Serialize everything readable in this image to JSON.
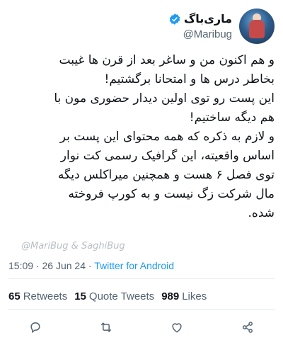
{
  "user": {
    "display_name": "ماری‌باگ",
    "handle": "@Maribug"
  },
  "tweet": {
    "lines": [
      "و هم اکنون من و ساغر بعد از قرن ها غیبت",
      "بخاطر درس ها و امتحانا برگشتیم!",
      "این پست رو توی اولین دیدار حضوری مون با",
      "هم دیگه ساختیم!",
      "و لازم به ذکره که همه محتوای این پست بر",
      "اساس واقعیته، این گرافیک رسمی کت نوار",
      "توی فصل ۶ هست و همچنین میراکلس دیگه",
      "مال شرکت زگ نیست و به کورپ فروخته",
      "شده."
    ],
    "watermark": "@MariBug & SaghiBug"
  },
  "meta": {
    "time": "15:09",
    "separator1": " · ",
    "date": "26 Jun 24",
    "separator2": " · ",
    "source": "Twitter for Android"
  },
  "stats": {
    "retweets_count": "65",
    "retweets_label": "Retweets",
    "quotes_count": "15",
    "quotes_label": "Quote Tweets",
    "likes_count": "989",
    "likes_label": "Likes"
  },
  "colors": {
    "accent": "#1d9bf0",
    "secondary_text": "#536471"
  },
  "icons": [
    "verified-badge-icon",
    "reply-icon",
    "retweet-icon",
    "like-icon",
    "share-icon"
  ]
}
